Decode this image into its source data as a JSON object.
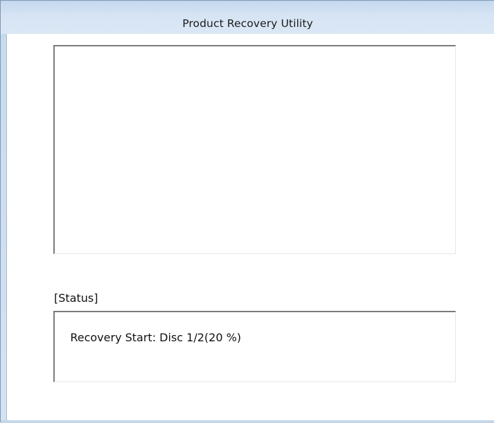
{
  "window": {
    "title": "Product Recovery Utility"
  },
  "status": {
    "label": "[Status]",
    "message": "Recovery Start: Disc 1/2(20 %)"
  },
  "colors": {
    "titlebar": "#d6e4f4",
    "frame": "#c8dbef",
    "client_background": "#ffffff",
    "text": "#111111"
  }
}
